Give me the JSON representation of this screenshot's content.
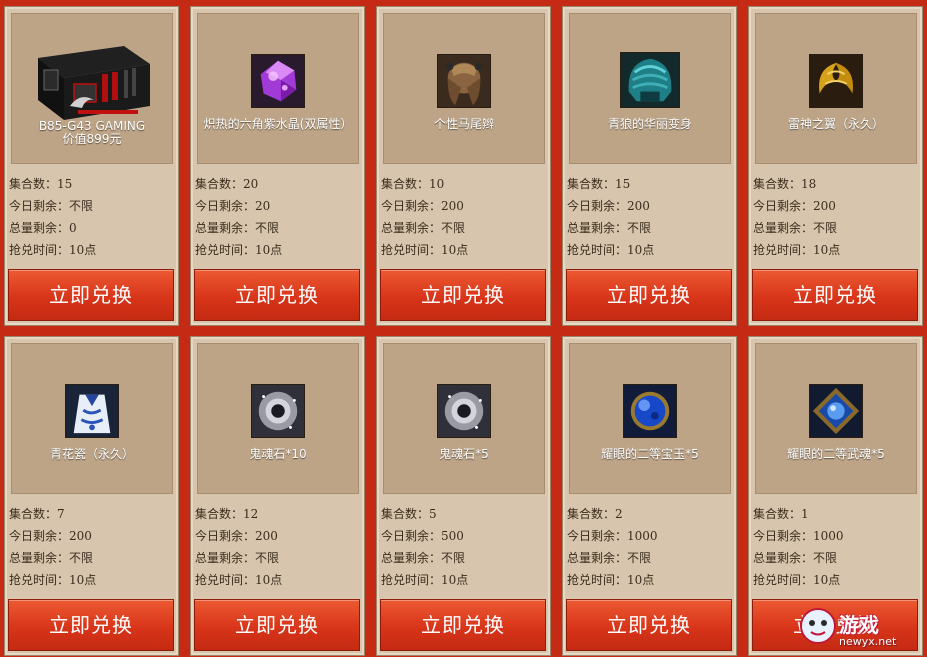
{
  "items": [
    {
      "name": "B85-G43 GAMING",
      "subname": "价值899元",
      "icon": "motherboard-icon",
      "stats": [
        "集合数：15",
        "今日剩余：不限",
        "总量剩余：0",
        "抢兑时间：10点"
      ],
      "button": "立即兑换"
    },
    {
      "name": "炽热的六角紫水晶(双属性）",
      "subname": "",
      "icon": "purple-crystal-icon",
      "stats": [
        "集合数：20",
        "今日剩余：20",
        "总量剩余：不限",
        "抢兑时间：10点"
      ],
      "button": "立即兑换"
    },
    {
      "name": "个性马尾辫",
      "subname": "",
      "icon": "ponytail-hair-icon",
      "stats": [
        "集合数：10",
        "今日剩余：200",
        "总量剩余：不限",
        "抢兑时间：10点"
      ],
      "button": "立即兑换"
    },
    {
      "name": "青狼的华丽变身",
      "subname": "",
      "icon": "wolf-helmet-icon",
      "stats": [
        "集合数：15",
        "今日剩余：200",
        "总量剩余：不限",
        "抢兑时间：10点"
      ],
      "button": "立即兑换"
    },
    {
      "name": "雷神之翼（永久）",
      "subname": "",
      "icon": "golden-wing-icon",
      "stats": [
        "集合数：18",
        "今日剩余：200",
        "总量剩余：不限",
        "抢兑时间：10点"
      ],
      "button": "立即兑换"
    },
    {
      "name": "青花瓷（永久）",
      "subname": "",
      "icon": "porcelain-outfit-icon",
      "stats": [
        "集合数：7",
        "今日剩余：200",
        "总量剩余：不限",
        "抢兑时间：10点"
      ],
      "button": "立即兑换"
    },
    {
      "name": "鬼魂石*10",
      "subname": "",
      "icon": "ghost-stone-icon",
      "stats": [
        "集合数：12",
        "今日剩余：200",
        "总量剩余：不限",
        "抢兑时间：10点"
      ],
      "button": "立即兑换"
    },
    {
      "name": "鬼魂石*5",
      "subname": "",
      "icon": "ghost-stone-icon",
      "stats": [
        "集合数：5",
        "今日剩余：500",
        "总量剩余：不限",
        "抢兑时间：10点"
      ],
      "button": "立即兑换"
    },
    {
      "name": "耀眼的二等宝玉*5",
      "subname": "",
      "icon": "blue-gem-icon",
      "stats": [
        "集合数：2",
        "今日剩余：1000",
        "总量剩余：不限",
        "抢兑时间：10点"
      ],
      "button": "立即兑换"
    },
    {
      "name": "耀眼的二等武魂*5",
      "subname": "",
      "icon": "blue-soul-gem-icon",
      "stats": [
        "集合数：1",
        "今日剩余：1000",
        "总量剩余：不限",
        "抢兑时间：10点"
      ],
      "button": "立即兑换"
    }
  ],
  "watermark": {
    "text": "游戏",
    "url": "newyx.net",
    "icon": "newyx-logo-icon"
  },
  "colors": {
    "page_bg": "#c42a14",
    "card_bg": "#d7c6ad",
    "image_bg": "#bda487",
    "button": "#d8351a",
    "stat_text": "#3b2b1c"
  }
}
